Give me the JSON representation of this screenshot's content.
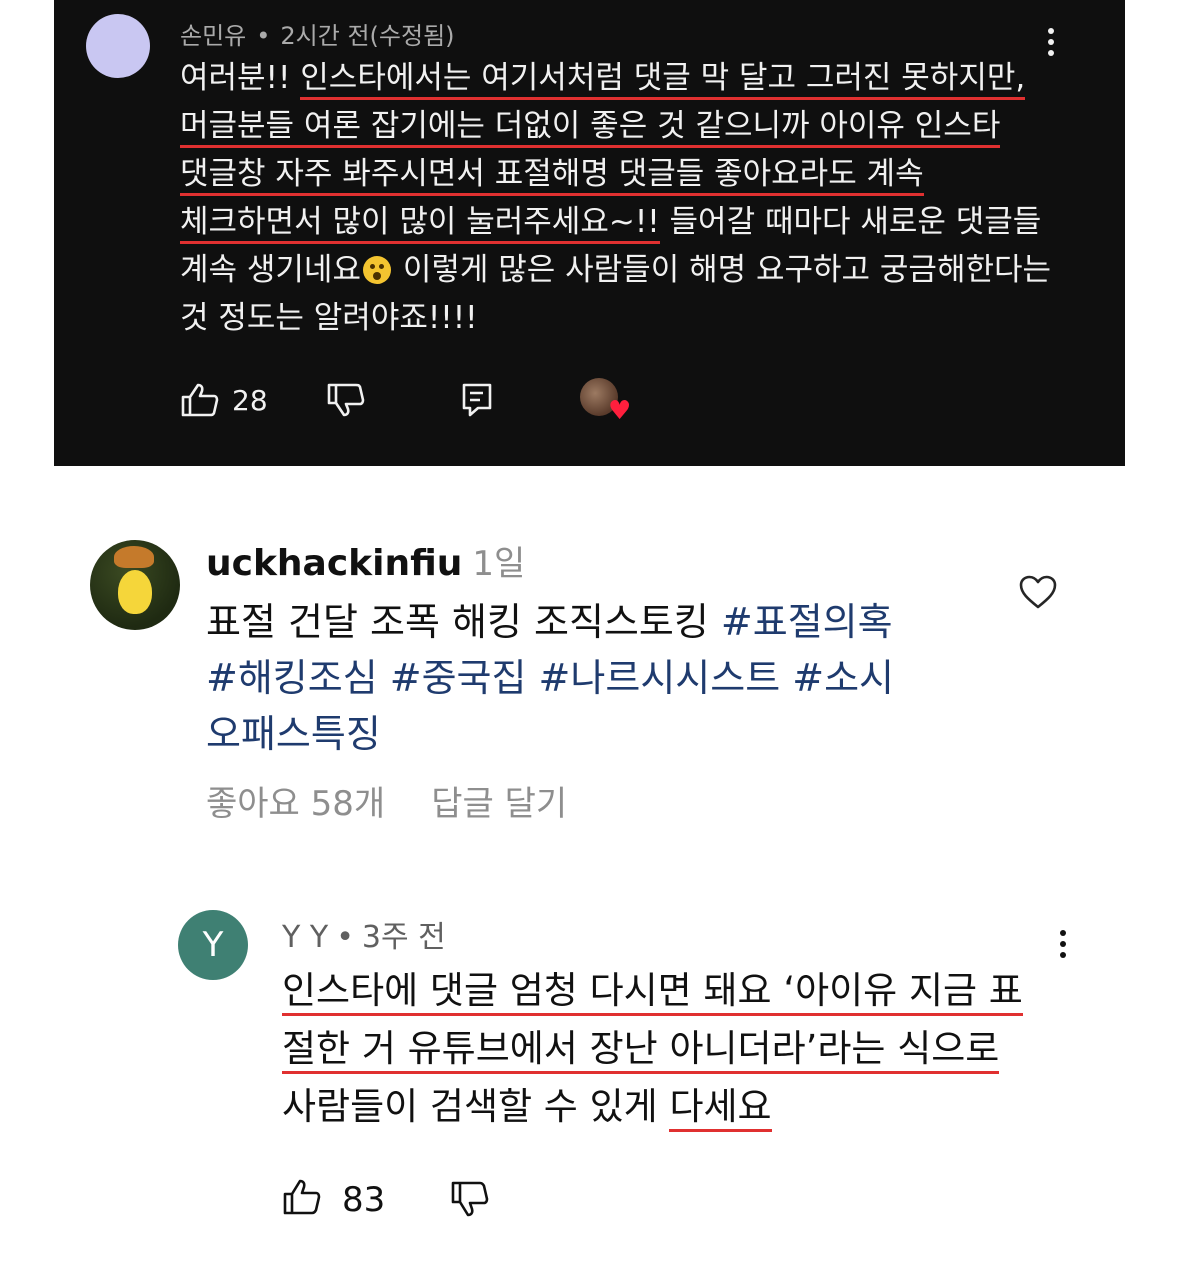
{
  "dark_comment": {
    "author": "손민유",
    "time": "2시간 전(수정됨)",
    "lines": [
      [
        "여러분!! ",
        "인스타에서는 여기서처럼 댓글 막 달고 그러진 못하지만,"
      ],
      [
        "머글분들 여론 잡기에는 더없이 좋은 것 같으니까 아이유 인스타",
        ""
      ],
      [
        "댓글창 자주 봐주시면서 표절해명 댓글들 좋아요라도 계속",
        ""
      ],
      [
        "체크하면서 많이 많이 눌러주세요~!!",
        " 들어갈 때마다 새로운 댓글들"
      ],
      [
        "계속 생기네요",
        " 이렇게 많은 사람들이 해명 요구하고 궁금해한다는"
      ],
      [
        "것 정도는 알려야죠!!!!",
        ""
      ]
    ],
    "like_count": "28",
    "creator_heart_symbol": "♥"
  },
  "ig_comment": {
    "username": "uckhackinfiu",
    "time": "1일",
    "lines": [
      {
        "plain": "표절 건달 조폭 해킹 조직스토킹 ",
        "tag": "#표절의혹"
      },
      {
        "plain": "",
        "tag": "#해킹조심 #중국집 #나르시시스트 #소시"
      },
      {
        "plain": "",
        "tag": "오패스특징"
      }
    ],
    "likes_label": "좋아요 58개",
    "reply_label": "답글 달기"
  },
  "yt_reply": {
    "avatar_letter": "Y",
    "author": "Y Y",
    "time": "3주 전",
    "lines": [
      "인스타에 댓글 엄청 다시면 돼요 ‘아이유 지금 표",
      "절한 거 유튜브에서 장난 아니더라’라는 식으로",
      [
        "사람들이 검색할 수 있게 ",
        "다세요"
      ]
    ],
    "like_count": "83"
  },
  "colors": {
    "dark_bg": "#0f0f0f",
    "underline_red": "#e03030",
    "hashtag_blue": "#1f3b6e",
    "yt_avatar_teal": "#3f8073"
  },
  "icons": [
    "thumbs-up-icon",
    "thumbs-down-icon",
    "reply-icon",
    "kebab-menu-icon",
    "heart-outline-icon",
    "creator-heart-icon"
  ]
}
